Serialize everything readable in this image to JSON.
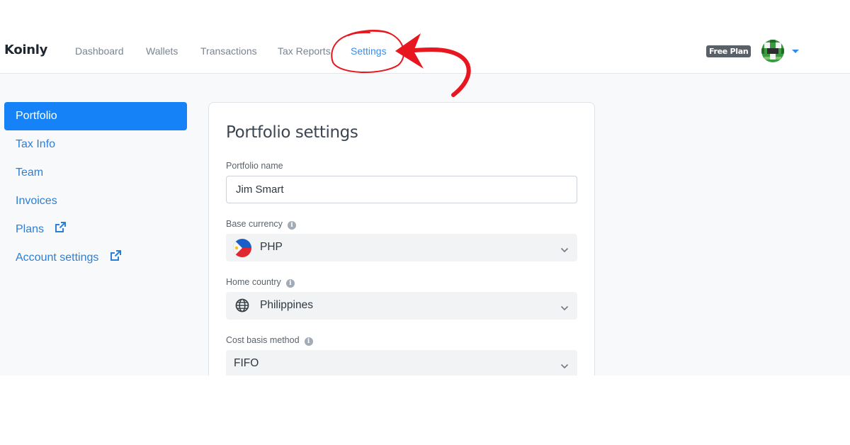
{
  "brand": "Koinly",
  "nav": {
    "dashboard": "Dashboard",
    "wallets": "Wallets",
    "transactions": "Transactions",
    "tax_reports": "Tax Reports",
    "settings": "Settings",
    "active": "settings"
  },
  "header": {
    "plan_badge": "Free Plan",
    "avatar_icon": "pixel-avatar-icon",
    "menu_icon": "caret-down-icon"
  },
  "sidebar": {
    "items": [
      {
        "label": "Portfolio",
        "active": true
      },
      {
        "label": "Tax Info"
      },
      {
        "label": "Team"
      },
      {
        "label": "Invoices"
      },
      {
        "label": "Plans",
        "icon": "external-link-icon"
      },
      {
        "label": "Account settings",
        "icon": "external-link-icon"
      }
    ]
  },
  "card": {
    "title": "Portfolio settings",
    "portfolio_name": {
      "label": "Portfolio name",
      "value": "Jim Smart"
    },
    "base_currency": {
      "label": "Base currency",
      "value": "PHP",
      "icon": "philippines-flag-icon"
    },
    "home_country": {
      "label": "Home country",
      "value": "Philippines",
      "icon": "globe-icon"
    },
    "cost_basis": {
      "label": "Cost basis method",
      "value": "FIFO"
    }
  },
  "colors": {
    "accent": "#1583f7",
    "link": "#2d7fd6",
    "annotation": "#e8171f",
    "badge": "#5a6067"
  }
}
